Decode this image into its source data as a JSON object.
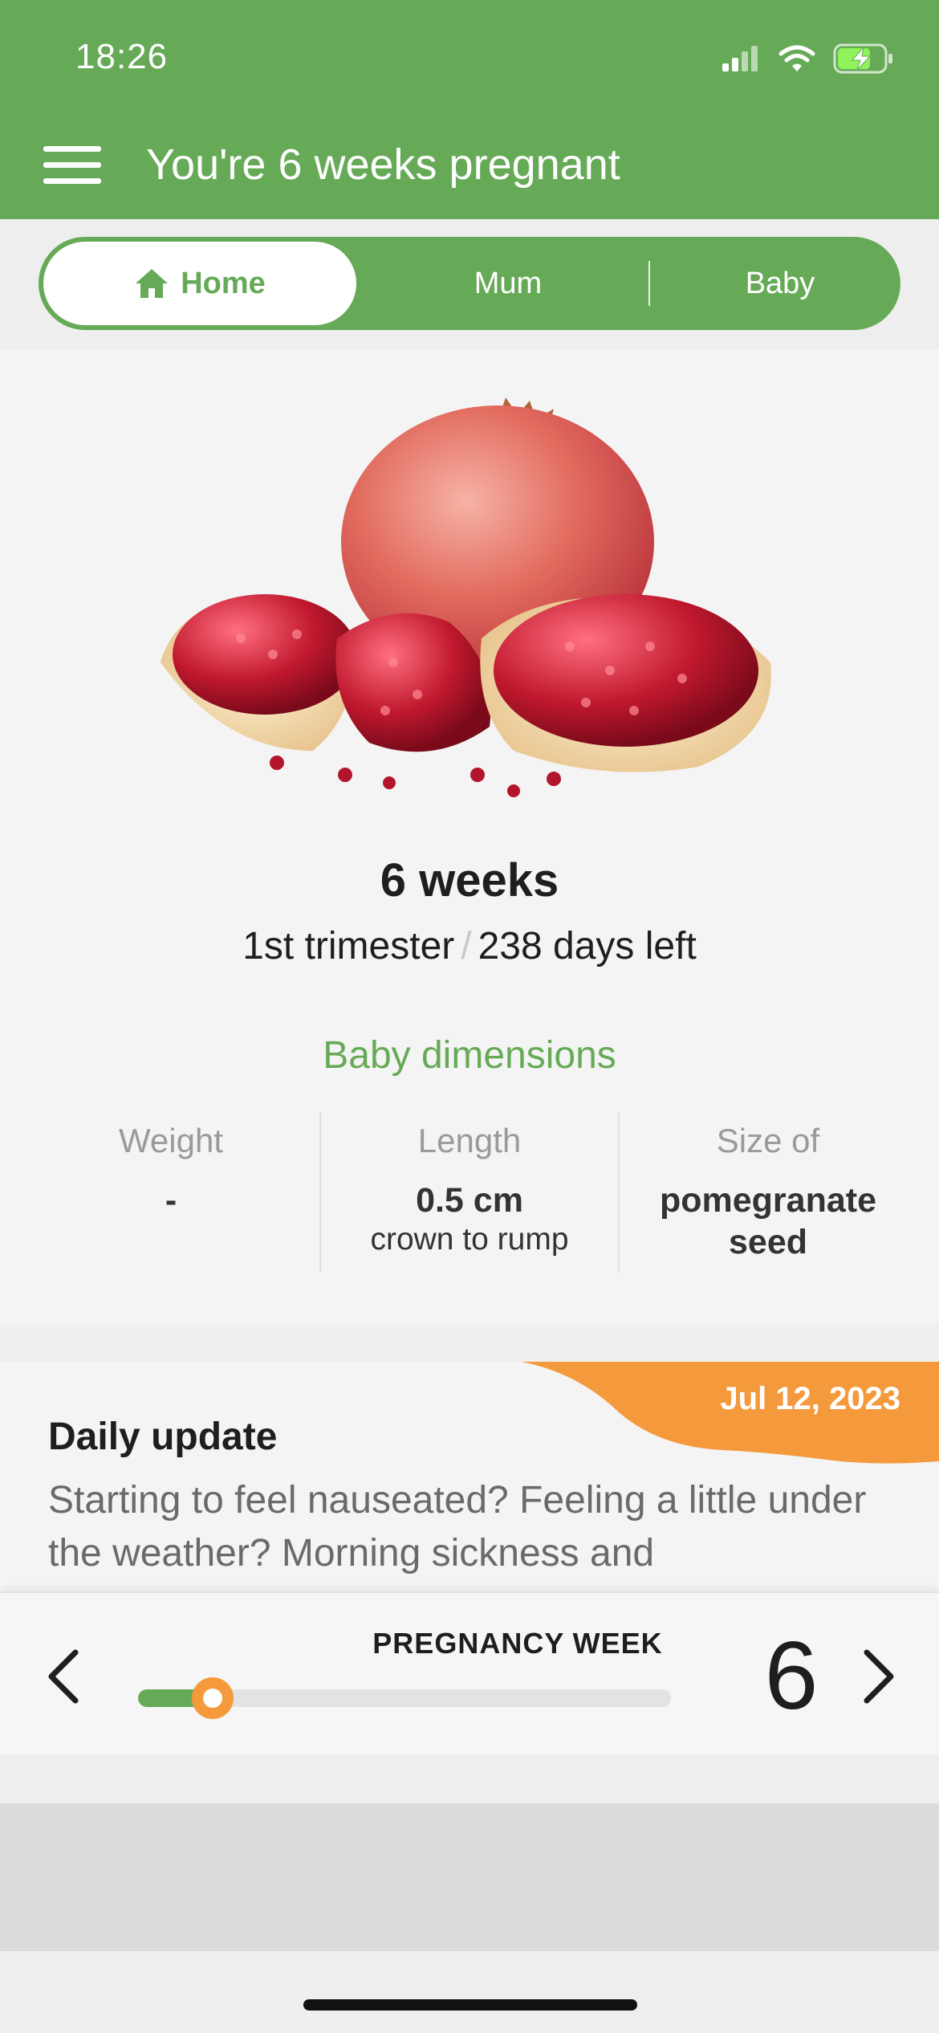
{
  "status_bar": {
    "time": "18:26",
    "icons": [
      "cellular-signal-icon",
      "wifi-icon",
      "battery-charging-icon"
    ]
  },
  "header": {
    "title": "You're 6 weeks pregnant",
    "menu_icon": "hamburger-menu-icon"
  },
  "tabs": [
    {
      "label": "Home",
      "icon": "home-icon",
      "selected": true
    },
    {
      "label": "Mum",
      "selected": false
    },
    {
      "label": "Baby",
      "selected": false
    }
  ],
  "overview": {
    "image": "pomegranate",
    "weeks": "6 weeks",
    "trimester": "1st trimester",
    "separator": "/",
    "days_left": "238 days left",
    "dimensions_heading": "Baby dimensions",
    "dimensions": [
      {
        "label": "Weight",
        "value": "-",
        "note": ""
      },
      {
        "label": "Length",
        "value": "0.5 cm",
        "note": "crown to rump"
      },
      {
        "label": "Size of",
        "value": "pomegranate seed",
        "note": ""
      }
    ]
  },
  "daily_update": {
    "date": "Jul 12, 2023",
    "title": "Daily update",
    "body": "Starting to feel nauseated? Feeling a little under the weather? Morning sickness and"
  },
  "week_selector": {
    "label": "PREGNANCY WEEK",
    "week": "6",
    "progress_fraction": 0.14,
    "prev_icon": "chevron-left-icon",
    "next_icon": "chevron-right-icon"
  },
  "colors": {
    "brand_green": "#66aa57",
    "accent_orange": "#f49a3c"
  }
}
